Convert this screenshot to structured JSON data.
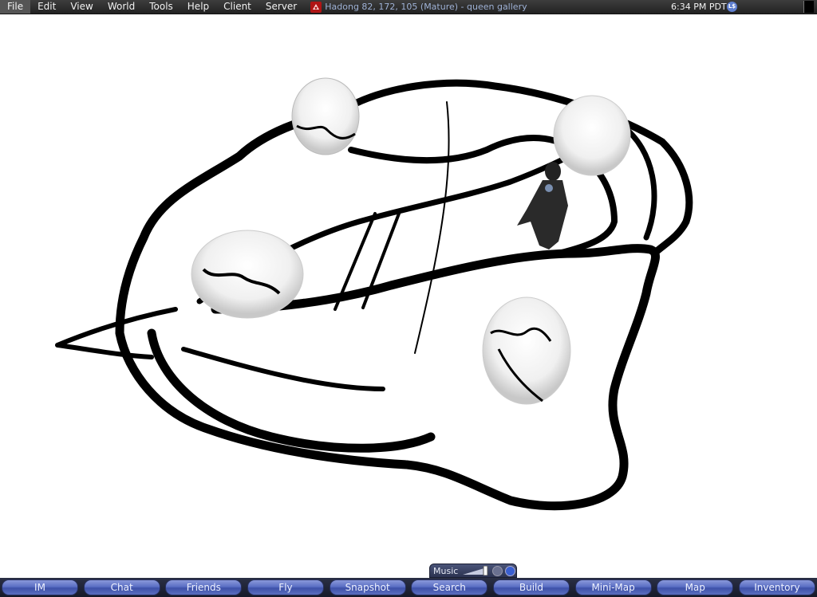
{
  "menubar": {
    "items": [
      "File",
      "Edit",
      "View",
      "World",
      "Tools",
      "Help",
      "Client",
      "Server"
    ],
    "location": "Hadong 82, 172, 105 (Mature) - queen gallery",
    "clock": "6:34 PM PDT",
    "ls_badge": "L$"
  },
  "music": {
    "label": "Music"
  },
  "toolbar": {
    "buttons": [
      "IM",
      "Chat",
      "Friends",
      "Fly",
      "Snapshot",
      "Search",
      "Build",
      "Mini-Map",
      "Map",
      "Inventory"
    ]
  },
  "colors": {
    "menubar": "#2a2a2a",
    "location_text": "#9fb2d6",
    "button_blue": "#5b6fc4",
    "toolbar_bg": "#1d2133"
  }
}
